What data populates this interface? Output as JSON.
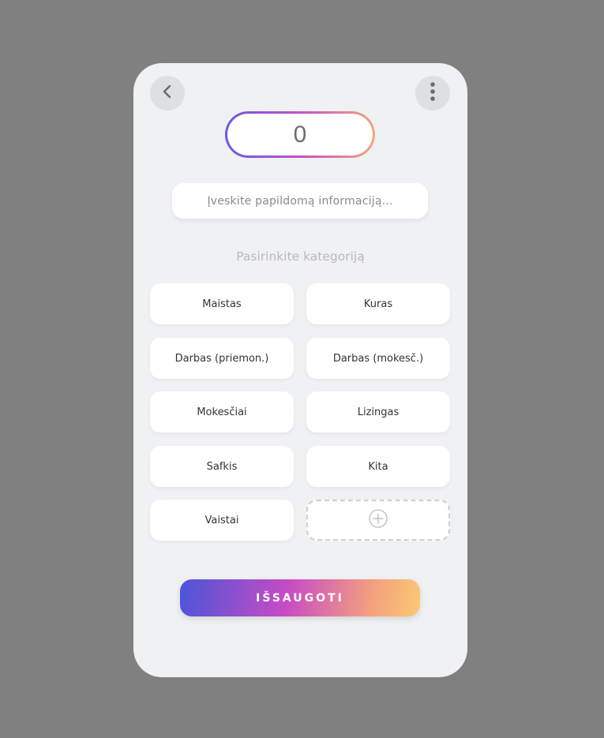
{
  "header": {
    "back_icon": "chevron-left-icon",
    "menu_icon": "vertical-dots-icon"
  },
  "amount": {
    "value": "0"
  },
  "info_input": {
    "placeholder": "Įveskite papildomą informaciją..."
  },
  "category_section": {
    "title": "Pasirinkite kategoriją",
    "categories": [
      {
        "label": "Maistas"
      },
      {
        "label": "Kuras"
      },
      {
        "label": "Darbas (priemon.)"
      },
      {
        "label": "Darbas (mokesč.)"
      },
      {
        "label": "Mokesčiai"
      },
      {
        "label": "Lizingas"
      },
      {
        "label": "Safkis"
      },
      {
        "label": "Kita"
      },
      {
        "label": "Vaistai"
      }
    ],
    "add_icon": "plus-circle-icon"
  },
  "save_button": {
    "label": "IŠSAUGOTI"
  },
  "colors": {
    "background": "#808080",
    "card": "#f0f1f3",
    "gradient_start": "#4a55d8",
    "gradient_mid": "#c84cc4",
    "gradient_end": "#fcc872"
  }
}
